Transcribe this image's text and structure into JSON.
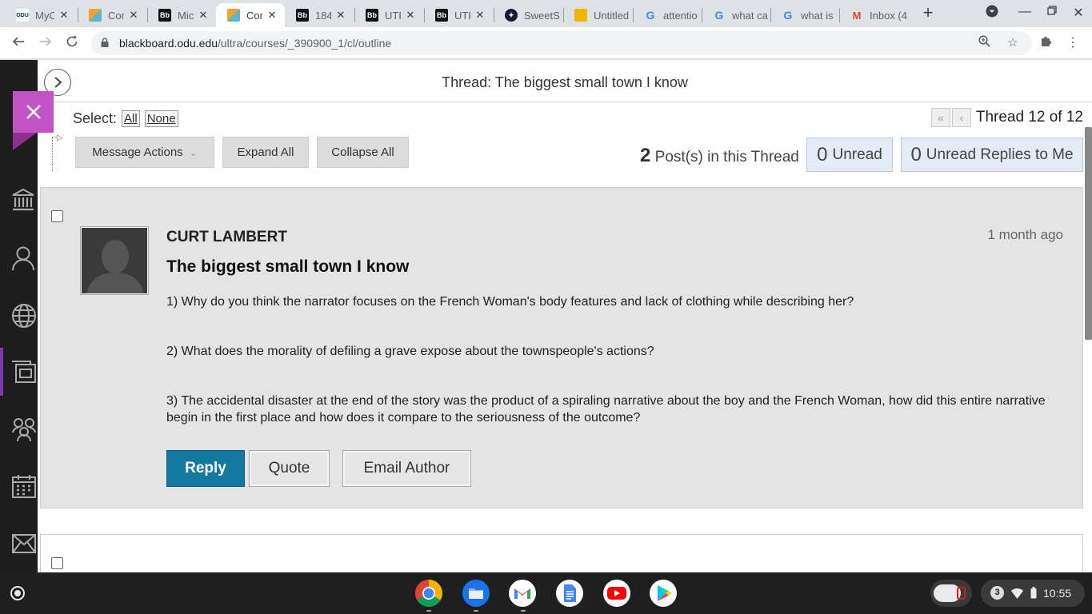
{
  "browser": {
    "tabs": [
      {
        "title": "MyO",
        "favicon": "odu-icon"
      },
      {
        "title": "Cor",
        "favicon": "pencil-icon"
      },
      {
        "title": "Mic",
        "favicon": "bb-icon"
      },
      {
        "title": "Cor",
        "favicon": "pencil-icon",
        "active": true
      },
      {
        "title": "184",
        "favicon": "bb-icon"
      },
      {
        "title": "UTF",
        "favicon": "bb-icon"
      },
      {
        "title": "UTF",
        "favicon": "bb-icon"
      },
      {
        "title": "SweetS",
        "favicon": "sweetstudy-icon"
      },
      {
        "title": "Untitled",
        "favicon": "slides-icon"
      },
      {
        "title": "attentio",
        "favicon": "google-icon"
      },
      {
        "title": "what ca",
        "favicon": "google-icon"
      },
      {
        "title": "what is",
        "favicon": "google-icon"
      },
      {
        "title": "Inbox (4",
        "favicon": "gmail-icon"
      }
    ],
    "url_host": "blackboard.odu.edu",
    "url_path": "/ultra/courses/_390900_1/cl/outline"
  },
  "panel": {
    "title": "Thread: The biggest small town I know",
    "select_label": "Select:",
    "select_all": "All",
    "select_none": "None",
    "thread_position": "Thread 12 of 12",
    "actions": {
      "message_actions": "Message Actions",
      "expand_all": "Expand All",
      "collapse_all": "Collapse All"
    },
    "stats": {
      "posts_count": "2",
      "posts_label": "Post(s) in this Thread",
      "unread_count": "0",
      "unread_label": "Unread",
      "unread_replies_count": "0",
      "unread_replies_label": "Unread Replies to Me"
    }
  },
  "post": {
    "author": "CURT LAMBERT",
    "time": "1 month ago",
    "subject": "The biggest small town I know",
    "paragraphs": [
      "1) Why do you think the narrator focuses on the French Woman's body features and lack of clothing while describing her?",
      "2) What does the morality of defiling a grave expose about the townspeople's actions?",
      "3) The accidental disaster at the end of the story was the product of a spiraling narrative about the boy and the French Woman, how did this entire narrative begin in the first place and how does it compare to the seriousness of the outcome?"
    ],
    "reply": "Reply",
    "quote": "Quote",
    "email_author": "Email Author"
  },
  "shelf": {
    "notification_count": "3",
    "time": "10:55"
  },
  "colors": {
    "accent_purple": "#c252c6",
    "reply_blue": "#1379a3",
    "rail_bg": "#1d1d1d"
  }
}
